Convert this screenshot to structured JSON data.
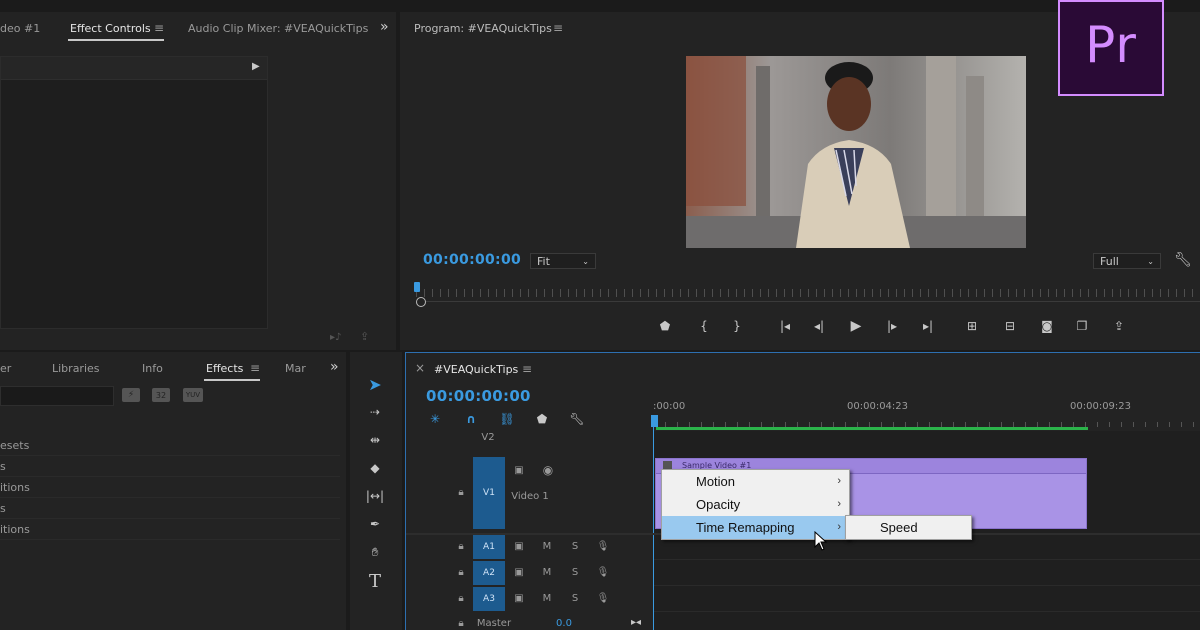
{
  "source_panel": {
    "tabs": [
      {
        "label": "deo #1",
        "active": false
      },
      {
        "label": "Effect Controls",
        "active": true
      },
      {
        "label": "Audio Clip Mixer: #VEAQuickTips",
        "active": false
      }
    ],
    "overflow": "»"
  },
  "program_monitor": {
    "title": "Program: #VEAQuickTips",
    "timecode": "00:00:00:00",
    "zoom_select": "Fit",
    "quality_select": "Full"
  },
  "effects_panel": {
    "tabs": [
      {
        "label": "er",
        "active": false
      },
      {
        "label": "Libraries",
        "active": false
      },
      {
        "label": "Info",
        "active": false
      },
      {
        "label": "Effects",
        "active": true
      },
      {
        "label": "Mar",
        "active": false
      }
    ],
    "overflow": "»",
    "list": [
      "esets",
      "s",
      "itions",
      "s",
      "itions"
    ]
  },
  "timeline": {
    "title": "#VEAQuickTips",
    "close": "×",
    "timecode": "00:00:00:00",
    "ruler": [
      ":00:00",
      "00:00:04:23",
      "00:00:09:23"
    ],
    "tracks": {
      "v2": "V2",
      "v1": "V1",
      "v1_name": "Video 1",
      "a1": "A1",
      "a2": "A2",
      "a3": "A3",
      "master": "Master",
      "master_value": "0.0",
      "mute": "M",
      "solo": "S"
    },
    "clip_name": "Sample Video #1"
  },
  "context_menu": {
    "items": [
      {
        "label": "Motion",
        "arrow": "›"
      },
      {
        "label": "Opacity",
        "arrow": "›"
      },
      {
        "label": "Time Remapping",
        "arrow": "›",
        "highlighted": true
      }
    ],
    "submenu": [
      "Speed"
    ]
  },
  "logo": {
    "text": "Pr"
  },
  "colors": {
    "accent_blue": "#3a9ae0",
    "clip_purple": "#a993e6",
    "logo_purple": "#d48cff",
    "logo_bg": "#2a0a36",
    "track_blue": "#1d5b8f",
    "work_area_green": "#2bb34a"
  }
}
